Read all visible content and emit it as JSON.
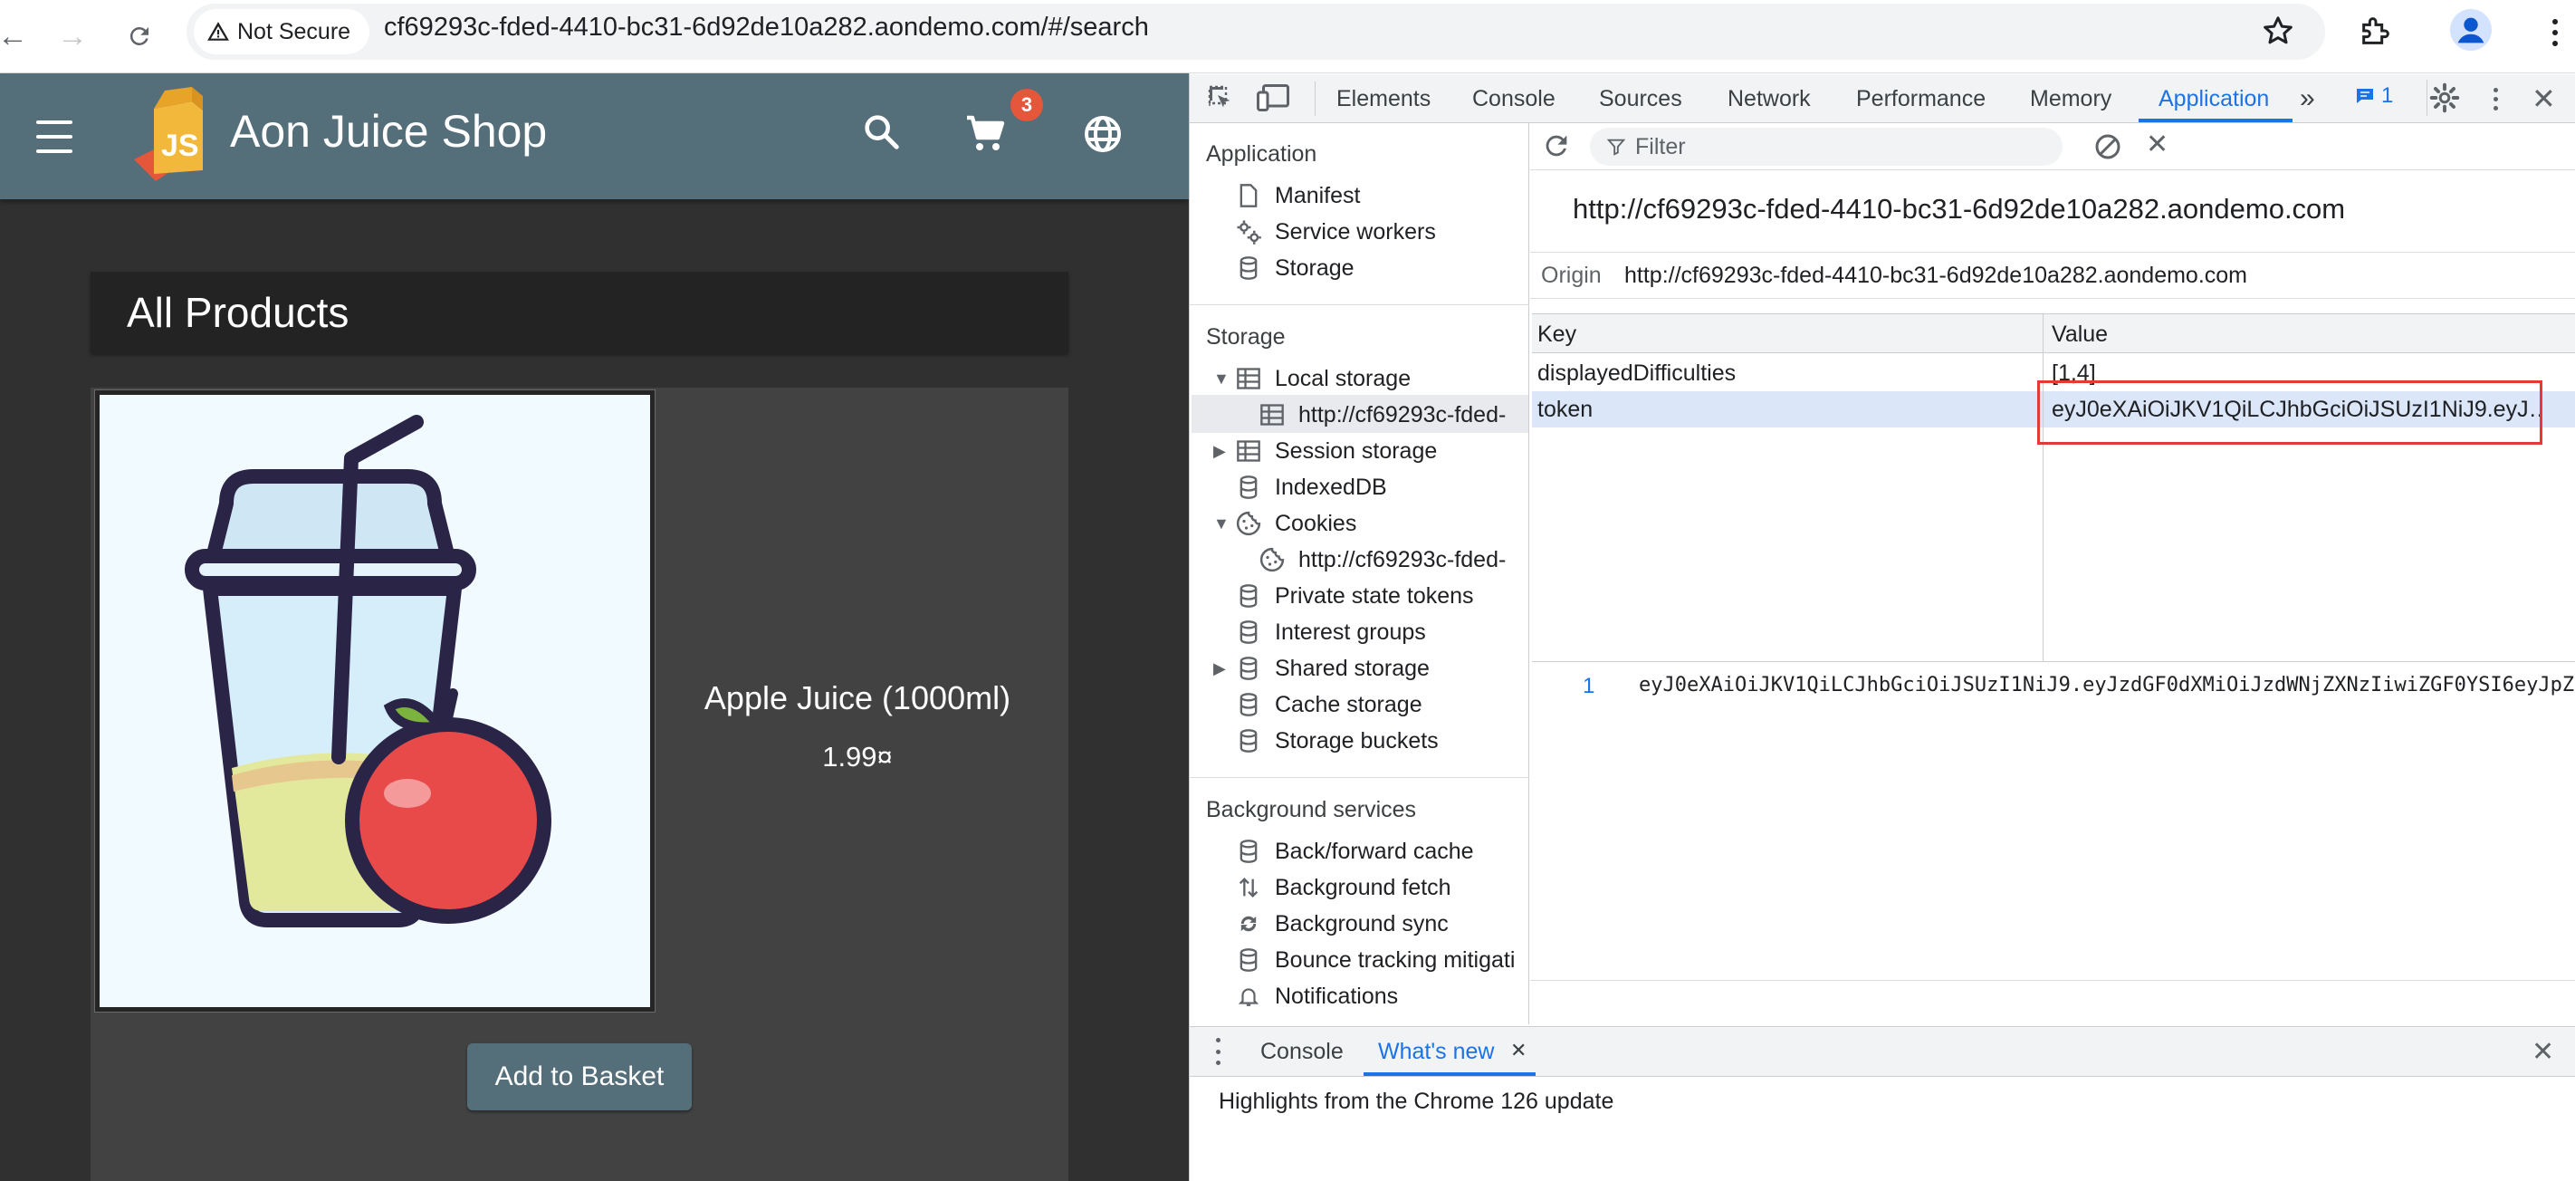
{
  "browser": {
    "security_label": "Not Secure",
    "url": "cf69293c-fded-4410-bc31-6d92de10a282.aondemo.com/#/search"
  },
  "app": {
    "title": "Aon Juice Shop",
    "cart_count": "3",
    "section_title": "All Products",
    "product": {
      "name": "Apple Juice (1000ml)",
      "price": "1.99¤"
    },
    "add_to_basket": "Add to Basket",
    "colors": {
      "toolbar": "#546e7a",
      "background": "#303030",
      "card": "#424242",
      "badge": "#e4573a"
    }
  },
  "devtools": {
    "tabs": [
      "Elements",
      "Console",
      "Sources",
      "Network",
      "Performance",
      "Memory",
      "Application"
    ],
    "active_tab": "Application",
    "issues_count": "1",
    "sidebar": {
      "application_title": "Application",
      "application_items": [
        "Manifest",
        "Service workers",
        "Storage"
      ],
      "storage_title": "Storage",
      "local_storage": "Local storage",
      "local_storage_child": "http://cf69293c-fded-",
      "session_storage": "Session storage",
      "indexeddb": "IndexedDB",
      "cookies": "Cookies",
      "cookies_child": "http://cf69293c-fded-",
      "private_state_tokens": "Private state tokens",
      "interest_groups": "Interest groups",
      "shared_storage": "Shared storage",
      "cache_storage": "Cache storage",
      "storage_buckets": "Storage buckets",
      "background_title": "Background services",
      "background_items": [
        "Back/forward cache",
        "Background fetch",
        "Background sync",
        "Bounce tracking mitigati",
        "Notifications"
      ]
    },
    "filter_placeholder": "Filter",
    "origin_title": "http://cf69293c-fded-4410-bc31-6d92de10a282.aondemo.com",
    "origin_label": "Origin",
    "origin_value": "http://cf69293c-fded-4410-bc31-6d92de10a282.aondemo.com",
    "table": {
      "headers": [
        "Key",
        "Value"
      ],
      "rows": [
        {
          "key": "displayedDifficulties",
          "value": "[1,4]"
        },
        {
          "key": "token",
          "value": "eyJ0eXAiOiJKV1QiLCJhbGciOiJSUzI1NiJ9.eyJ…"
        }
      ]
    },
    "preview": {
      "line_number": "1",
      "text": "eyJ0eXAiOiJKV1QiLCJhbGciOiJSUzI1NiJ9.eyJzdGF0dXMiOiJzdWNjZXNzIiwiZGF0YSI6eyJpZ"
    },
    "drawer": {
      "tabs": [
        "Console",
        "What's new"
      ],
      "active": "What's new",
      "content": "Highlights from the Chrome 126 update"
    }
  }
}
